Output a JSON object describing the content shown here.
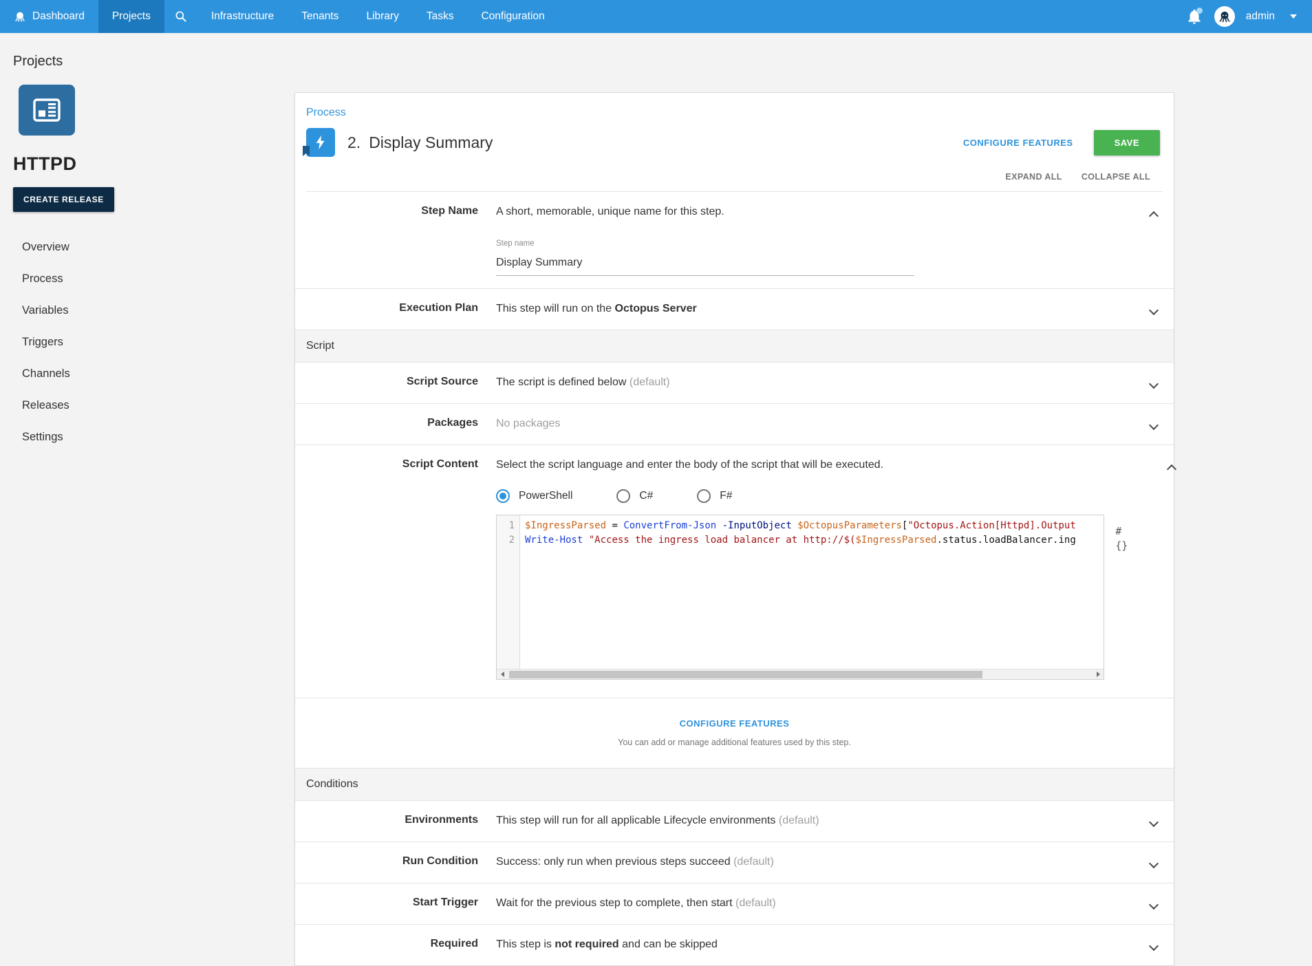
{
  "colors": {
    "nav_blue": "#2e93dd",
    "nav_active_blue": "#1d79bd",
    "accent_blue": "#2e93dd",
    "save_green": "#48b350",
    "create_release_navy": "#0d2b45",
    "logo_blue": "#2d6da0",
    "code_variable": "#c7641a",
    "code_cmdlet": "#1a3fd4",
    "code_param": "#001080",
    "code_string": "#a31515"
  },
  "topnav": {
    "items": [
      {
        "label": "Dashboard",
        "active": false,
        "icon": "octopus"
      },
      {
        "label": "Projects",
        "active": true
      },
      {
        "label": "",
        "active": false,
        "icon": "search"
      },
      {
        "label": "Infrastructure",
        "active": false
      },
      {
        "label": "Tenants",
        "active": false
      },
      {
        "label": "Library",
        "active": false
      },
      {
        "label": "Tasks",
        "active": false
      },
      {
        "label": "Configuration",
        "active": false
      }
    ],
    "user": {
      "name": "admin"
    }
  },
  "page_title": "Projects",
  "sidebar": {
    "project_name": "HTTPD",
    "create_release_label": "CREATE RELEASE",
    "items": [
      "Overview",
      "Process",
      "Variables",
      "Triggers",
      "Channels",
      "Releases",
      "Settings"
    ]
  },
  "process": {
    "breadcrumb": "Process",
    "step_number": "2.",
    "step_title": "Display Summary",
    "configure_features_label": "CONFIGURE FEATURES",
    "save_label": "SAVE",
    "expand_all": "EXPAND ALL",
    "collapse_all": "COLLAPSE ALL",
    "sections": {
      "script": "Script",
      "conditions": "Conditions"
    },
    "rows": {
      "step_name": {
        "label": "Step Name",
        "desc": "A short, memorable, unique name for this step.",
        "field_label": "Step name",
        "field_value": "Display Summary"
      },
      "execution_plan": {
        "label": "Execution Plan",
        "desc_prefix": "This step will run on the ",
        "desc_bold": "Octopus Server"
      },
      "script_source": {
        "label": "Script Source",
        "desc": "The script is defined below ",
        "default_suffix": "(default)"
      },
      "packages": {
        "label": "Packages",
        "desc": "No packages"
      },
      "script_content": {
        "label": "Script Content",
        "desc": "Select the script language and enter the body of the script that will be executed."
      },
      "environments": {
        "label": "Environments",
        "desc": "This step will run for all applicable Lifecycle environments ",
        "default_suffix": "(default)"
      },
      "run_condition": {
        "label": "Run Condition",
        "desc": "Success: only run when previous steps succeed ",
        "default_suffix": "(default)"
      },
      "start_trigger": {
        "label": "Start Trigger",
        "desc": "Wait for the previous step to complete, then start ",
        "default_suffix": "(default)"
      },
      "required": {
        "label": "Required",
        "desc_prefix": "This step is ",
        "desc_bold": "not required",
        "desc_suffix": " and can be skipped"
      }
    },
    "configure_features_block": {
      "label": "CONFIGURE FEATURES",
      "hint": "You can add or manage additional features used by this step."
    }
  },
  "script_editor": {
    "languages": [
      {
        "label": "PowerShell",
        "selected": true
      },
      {
        "label": "C#",
        "selected": false
      },
      {
        "label": "F#",
        "selected": false
      }
    ],
    "insert_variable_icon": "#{}",
    "lines": [
      {
        "num": "1",
        "tokens": [
          {
            "t": "$IngressParsed",
            "c": "variable"
          },
          {
            "t": " = ",
            "c": "plain"
          },
          {
            "t": "ConvertFrom-Json",
            "c": "cmdlet"
          },
          {
            "t": " ",
            "c": "plain"
          },
          {
            "t": "-InputObject",
            "c": "param"
          },
          {
            "t": " ",
            "c": "plain"
          },
          {
            "t": "$OctopusParameters",
            "c": "variable"
          },
          {
            "t": "[",
            "c": "plain"
          },
          {
            "t": "\"Octopus.Action[Httpd].Output",
            "c": "string"
          }
        ]
      },
      {
        "num": "2",
        "tokens": [
          {
            "t": "Write-Host",
            "c": "cmdlet"
          },
          {
            "t": " ",
            "c": "plain"
          },
          {
            "t": "\"Access the ingress load balancer at http://$(",
            "c": "string"
          },
          {
            "t": "$IngressParsed",
            "c": "variable"
          },
          {
            "t": ".status.loadBalancer.ing",
            "c": "plain"
          }
        ]
      }
    ]
  }
}
